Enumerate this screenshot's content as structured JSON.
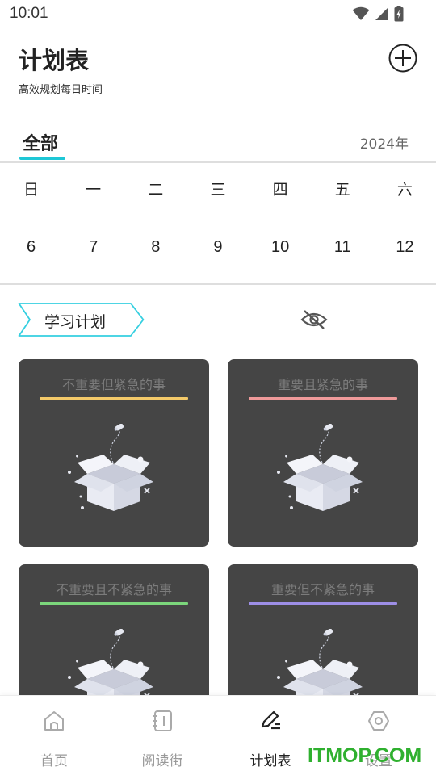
{
  "status": {
    "time": "10:01"
  },
  "header": {
    "title": "计划表",
    "subtitle": "高效规划每日时间"
  },
  "tabs": {
    "active": "全部",
    "year": "2024年"
  },
  "week": {
    "days": [
      "日",
      "一",
      "二",
      "三",
      "四",
      "五",
      "六"
    ],
    "dates": [
      "6",
      "7",
      "8",
      "9",
      "10",
      "11",
      "12"
    ]
  },
  "plan_tag": {
    "label": "学习计划"
  },
  "colors": {
    "accent": "#1ec7d6",
    "card_bg": "#454545",
    "line_yellow": "#f3c969",
    "line_pink": "#ef9a9a",
    "line_green": "#7bd67b",
    "line_purple": "#9d8ee6",
    "watermark": "#2fb02f"
  },
  "cards": [
    {
      "title": "不重要但紧急的事"
    },
    {
      "title": "重要且紧急的事"
    },
    {
      "title": "不重要且不紧急的事"
    },
    {
      "title": "重要但不紧急的事"
    }
  ],
  "nav": {
    "items": [
      {
        "label": "首页",
        "icon": "home-icon"
      },
      {
        "label": "阅读街",
        "icon": "notebook-icon"
      },
      {
        "label": "计划表",
        "icon": "pen-edit-icon"
      },
      {
        "label": "设置",
        "icon": "hexagon-settings-icon"
      }
    ]
  },
  "watermark": {
    "text": "ITMOP.COM"
  }
}
